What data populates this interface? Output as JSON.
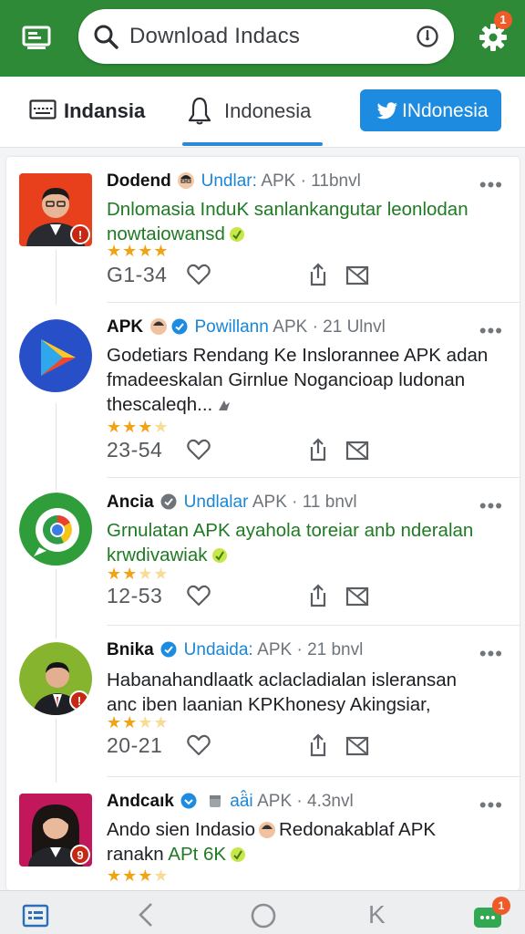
{
  "search": {
    "query": "Download Indacs"
  },
  "settings_badge": "1",
  "tabs": [
    {
      "label": "Indansia"
    },
    {
      "label": "Indonesia"
    },
    {
      "label": "INdonesia"
    }
  ],
  "posts": [
    {
      "name": "Dodend",
      "handle": "Undlar:",
      "meta": "APK · 11bnvl",
      "lines": [
        "Dnlomasia InduK sanlankangutar leonlodan",
        "nowtaiowansd"
      ],
      "rating": 4,
      "count": "G1-34"
    },
    {
      "name": "APK",
      "handle": "Powillann",
      "meta": "APK · 21 Ulnvl",
      "lines": [
        "Godetiars Rendang Ke Inslorannee APK adan",
        "fmadeeskalan Girnlue Nogancioap ludonan",
        "thescaleqh..."
      ],
      "rating": 3,
      "count": "23-54"
    },
    {
      "name": "Ancia",
      "handle": "Undlalar",
      "meta": "APK · 11 bnvl",
      "lines": [
        "Grnulatan APK ayahola toreiar anb nderalan",
        "krwdivawiak"
      ],
      "rating": 2,
      "count": "12-53"
    },
    {
      "name": "Bnika",
      "handle": "Undaida:",
      "meta": "APK · 21 bnvl",
      "lines": [
        "Habanahandlaatk aclacladialan isleransan",
        "anc iben laanian KPKhonesy Akingsiar,"
      ],
      "rating": 2,
      "count": "20-21"
    },
    {
      "name": "Andcaık",
      "handle": "aä̂i",
      "meta": "APK · 4.3nvl",
      "lines": [
        "Ando sien Indasio",
        "Redonakablaf APK",
        "ranakn",
        "APt 6K"
      ],
      "rating": 4,
      "count": ""
    }
  ],
  "bottom_badge": "1",
  "colors": {
    "header_green": "#2f8a37",
    "accent_blue": "#1d8ce0",
    "star": "#f2a313",
    "badge": "#f05a28"
  }
}
